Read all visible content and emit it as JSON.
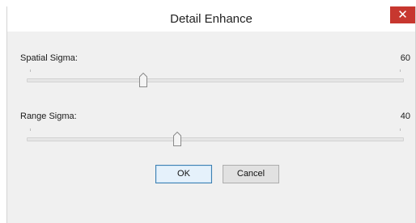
{
  "window": {
    "title": "Detail Enhance",
    "close_glyph": "✕"
  },
  "sliders": [
    {
      "label": "Spatial Sigma:",
      "value": "60",
      "position": 0.31
    },
    {
      "label": "Range Sigma:",
      "value": "40",
      "position": 0.4
    }
  ],
  "buttons": {
    "ok_label": "OK",
    "cancel_label": "Cancel"
  },
  "colors": {
    "close": "#c7372f",
    "dialog_bg": "#f0f0f0",
    "default_border": "#3c7fb1"
  }
}
